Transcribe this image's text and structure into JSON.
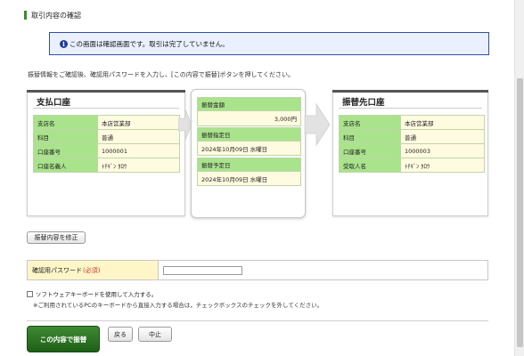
{
  "page_title": "取引内容の確認",
  "notice": {
    "icon": "info-icon",
    "message": "この画面は確認画面です。取引は完了していません。"
  },
  "instruction": "振替情報をご確認後、確認用パスワードを入力し、[この内容で振替]ボタンを押してください。",
  "payment_account": {
    "title": "支払口座",
    "rows": [
      {
        "label": "支店名",
        "value": "本店営業部"
      },
      {
        "label": "科目",
        "value": "普通"
      },
      {
        "label": "口座番号",
        "value": "1000001"
      },
      {
        "label": "口座名義人",
        "value": "ﾄﾁｷﾞﾝ ﾀﾛｳ"
      }
    ]
  },
  "transfer": {
    "amount_label": "振替金額",
    "amount_value": "3,000円",
    "designated_date_label": "振替指定日",
    "designated_date_value": "2024年10月09日 水曜日",
    "scheduled_date_label": "振替予定日",
    "scheduled_date_value": "2024年10月09日 水曜日"
  },
  "destination_account": {
    "title": "振替先口座",
    "rows": [
      {
        "label": "支店名",
        "value": "本店営業部"
      },
      {
        "label": "科目",
        "value": "普通"
      },
      {
        "label": "口座番号",
        "value": "1000003"
      },
      {
        "label": "受取人名",
        "value": "ﾄﾁｷﾞﾝ ﾀﾛｳ"
      }
    ]
  },
  "modify_button": "振替内容を修正",
  "password": {
    "label": "確認用パスワード",
    "required": "(必須)",
    "value": ""
  },
  "software_keyboard": {
    "label": "ソフトウェアキーボードを使用して入力する。",
    "note": "※ご利用されているPCのキーボードから直接入力する場合は，チェックボックスのチェックを外してください。",
    "checked": false
  },
  "buttons": {
    "submit": "この内容で振替",
    "back": "戻る",
    "cancel": "中止"
  },
  "colors": {
    "label_bg": "#a9e38c",
    "value_bg": "#fffbe0",
    "notice_bg": "#eaf0ff",
    "notice_border": "#2e4fa8",
    "submit_bg": "#2d7424",
    "required": "#c0392b"
  }
}
